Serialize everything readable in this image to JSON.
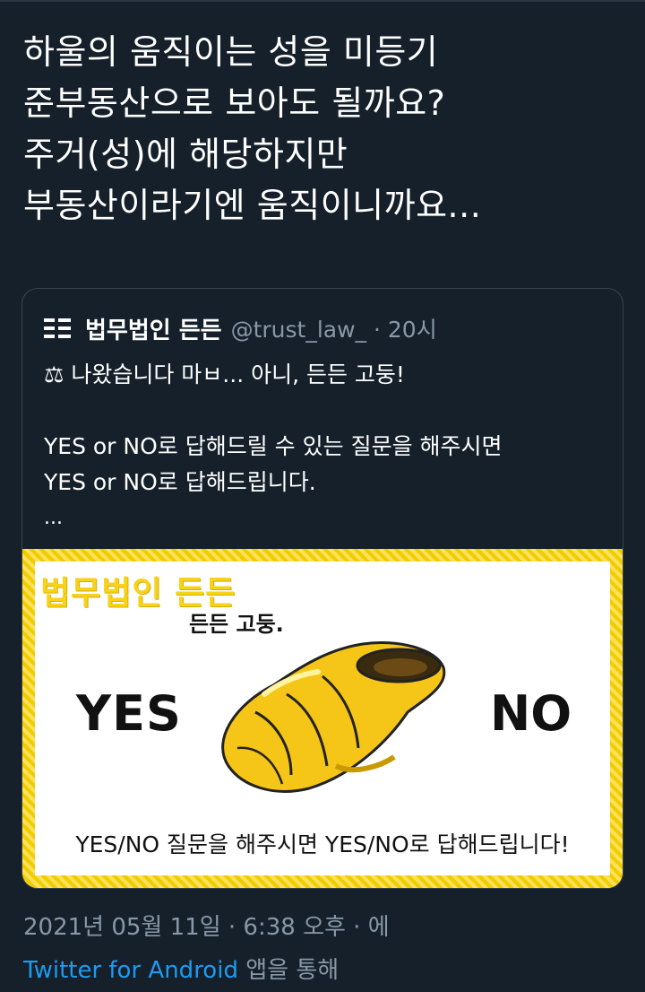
{
  "tweet": {
    "lines": [
      "하울의 움직이는 성을 미등기",
      "준부동산으로 보아도 될까요?",
      "주거(성)에 해당하지만",
      "부동산이라기엔 움직이니까요..."
    ]
  },
  "quote": {
    "author_name": "법무법인 든든",
    "handle_time": "@trust_law_ · 20시",
    "body": {
      "line1": "⚖ 나왔습니다 마ㅂ... 아니, 든든 고둥!",
      "line2": "YES or NO로 답해드릴 수 있는 질문을 해주시면",
      "line3": "YES or NO로 답해드립니다.",
      "ellipsis": "..."
    },
    "image": {
      "brand": "법무법인 든든",
      "subtitle": "든든 고둥.",
      "yes": "YES",
      "no": "NO",
      "caption": "YES/NO 질문을 해주시면 YES/NO로 답해드립니다!"
    }
  },
  "meta": {
    "timestamp": "2021년 05월 11일 · 6:38 오후 · 에",
    "source": "Twitter for Android",
    "source_suffix": " 앱을 통해"
  },
  "colors": {
    "background": "#15202b",
    "text": "#ffffff",
    "muted": "#8899a6",
    "link": "#1d9bf0",
    "card_border": "#38444d",
    "image_border": "#f2d200"
  },
  "icons": {
    "avatar": "brand-logo-icon",
    "scales": "scales-icon",
    "shell": "conch-shell-icon"
  }
}
